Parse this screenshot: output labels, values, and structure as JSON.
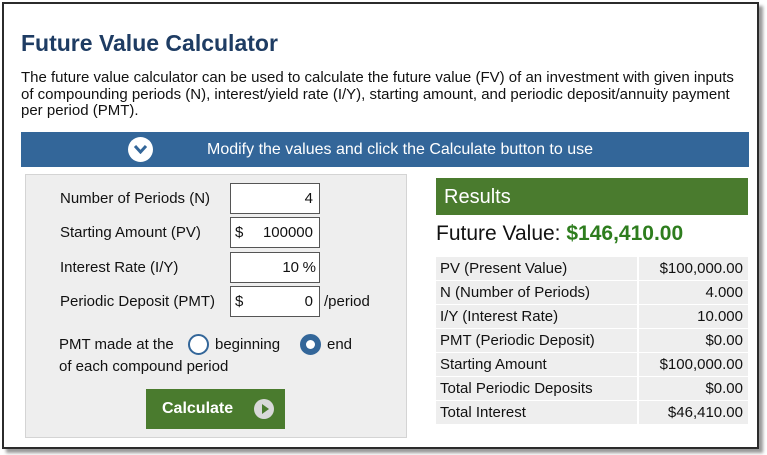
{
  "title": "Future Value Calculator",
  "description": "The future value calculator can be used to calculate the future value (FV) of an investment with given inputs of compounding periods (N), interest/yield rate (I/Y), starting amount, and periodic deposit/annuity payment per period (PMT).",
  "banner": {
    "text": "Modify the values and click the Calculate button to use",
    "icon": "chevron-down-circle-icon"
  },
  "inputs": {
    "periods": {
      "label": "Number of Periods (N)",
      "value": "4"
    },
    "starting": {
      "label": "Starting Amount (PV)",
      "prefix": "$",
      "value": "100000"
    },
    "rate": {
      "label": "Interest Rate (I/Y)",
      "value": "10",
      "suffix": "%"
    },
    "deposit": {
      "label": "Periodic Deposit (PMT)",
      "prefix": "$",
      "value": "0",
      "after": "/period"
    }
  },
  "pmt": {
    "label_line1": "PMT made at the",
    "label_line2": "of each compound period",
    "option_beginning": "beginning",
    "option_end": "end",
    "selected": "end"
  },
  "calculate_label": "Calculate",
  "results": {
    "heading": "Results",
    "fv_label": "Future Value:",
    "fv_value": "$146,410.00",
    "rows": [
      {
        "label": "PV (Present Value)",
        "value": "$100,000.00"
      },
      {
        "label": "N (Number of Periods)",
        "value": "4.000"
      },
      {
        "label": "I/Y (Interest Rate)",
        "value": "10.000"
      },
      {
        "label": "PMT (Periodic Deposit)",
        "value": "$0.00"
      },
      {
        "label": "Starting Amount",
        "value": "$100,000.00"
      },
      {
        "label": "Total Periodic Deposits",
        "value": "$0.00"
      },
      {
        "label": "Total Interest",
        "value": "$46,410.00"
      }
    ]
  },
  "colors": {
    "title": "#1e3c63",
    "banner": "#336699",
    "green": "#4a7b2e",
    "fv": "#2e7d1e"
  }
}
